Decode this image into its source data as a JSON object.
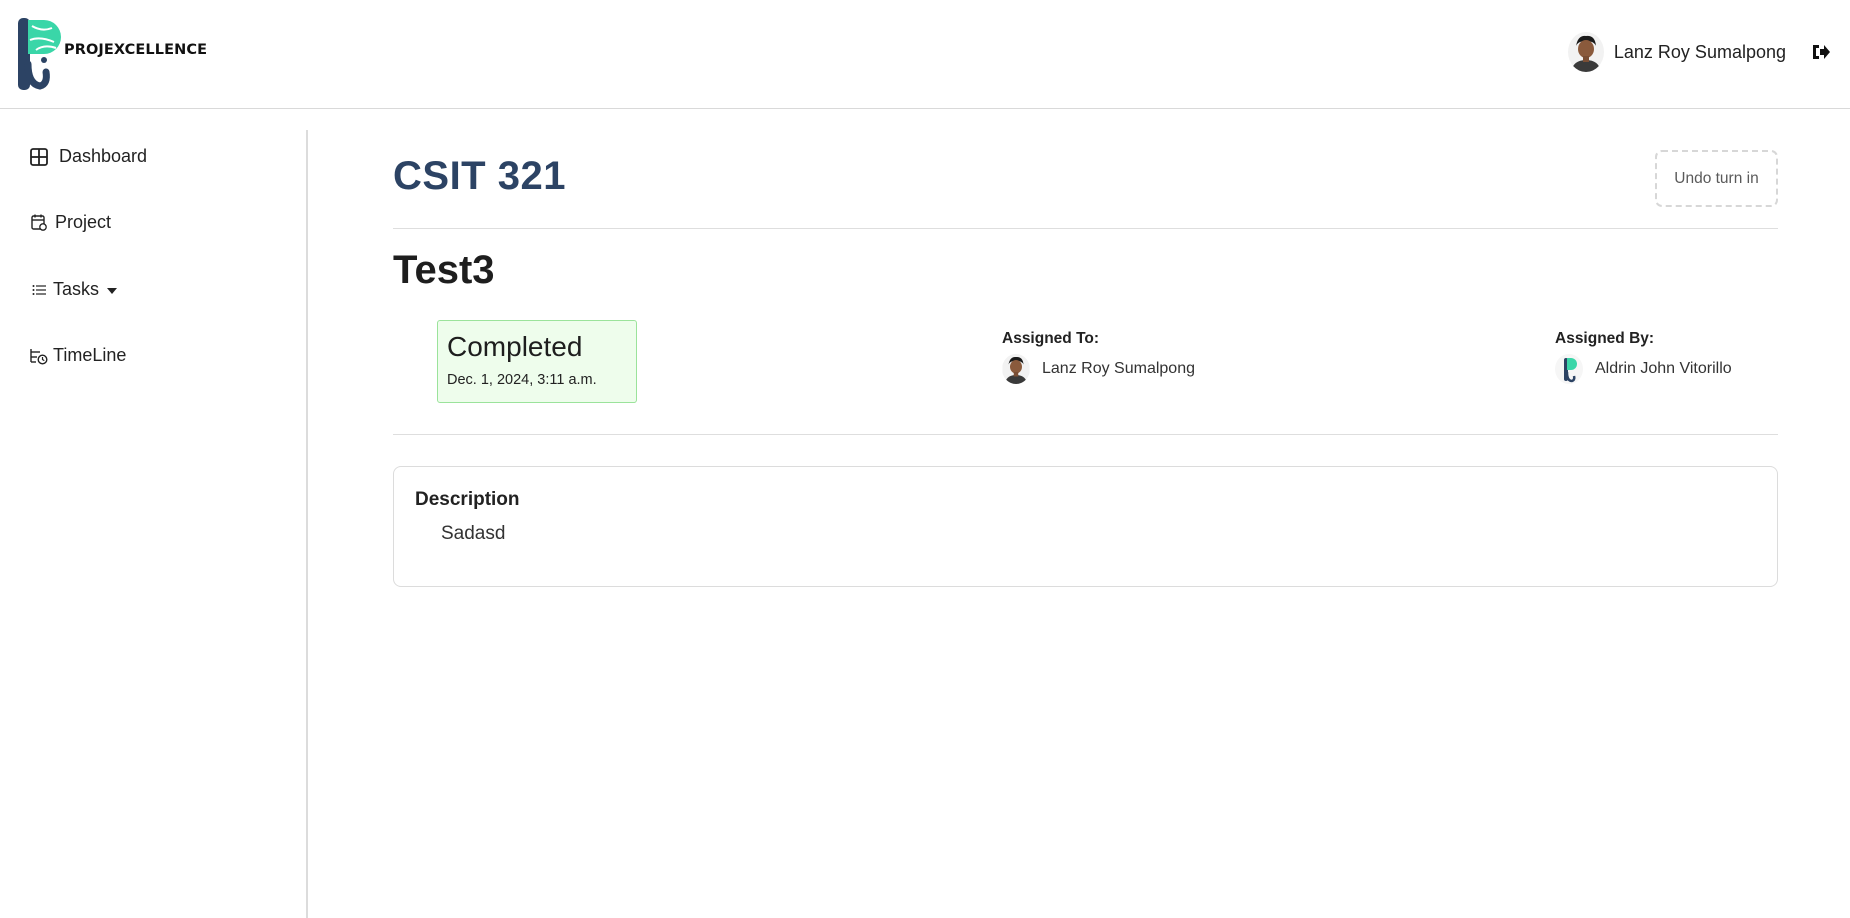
{
  "app": {
    "brand_name": "PROJEXCELLENCE",
    "colors": {
      "brand_teal": "#3ad6a8",
      "brand_navy": "#2c4364",
      "status_bg": "#eefdec",
      "status_border": "#9be39b"
    }
  },
  "header": {
    "user_name": "Lanz Roy Sumalpong",
    "logout_icon": "logout-icon"
  },
  "sidebar": {
    "items": [
      {
        "label": "Dashboard",
        "icon": "grid-icon"
      },
      {
        "label": "Project",
        "icon": "calendar-icon"
      },
      {
        "label": "Tasks",
        "icon": "list-icon"
      },
      {
        "label": "TimeLine",
        "icon": "timeline-icon"
      }
    ]
  },
  "main": {
    "course_title": "CSIT 321",
    "undo_button": "Undo turn in",
    "task_title": "Test3",
    "status": {
      "label": "Completed",
      "date": "Dec. 1, 2024, 3:11 a.m."
    },
    "assigned_to": {
      "label": "Assigned To:",
      "name": "Lanz Roy Sumalpong"
    },
    "assigned_by": {
      "label": "Assigned By:",
      "name": "Aldrin John Vitorillo"
    },
    "description": {
      "heading": "Description",
      "text": "Sadasd"
    }
  }
}
